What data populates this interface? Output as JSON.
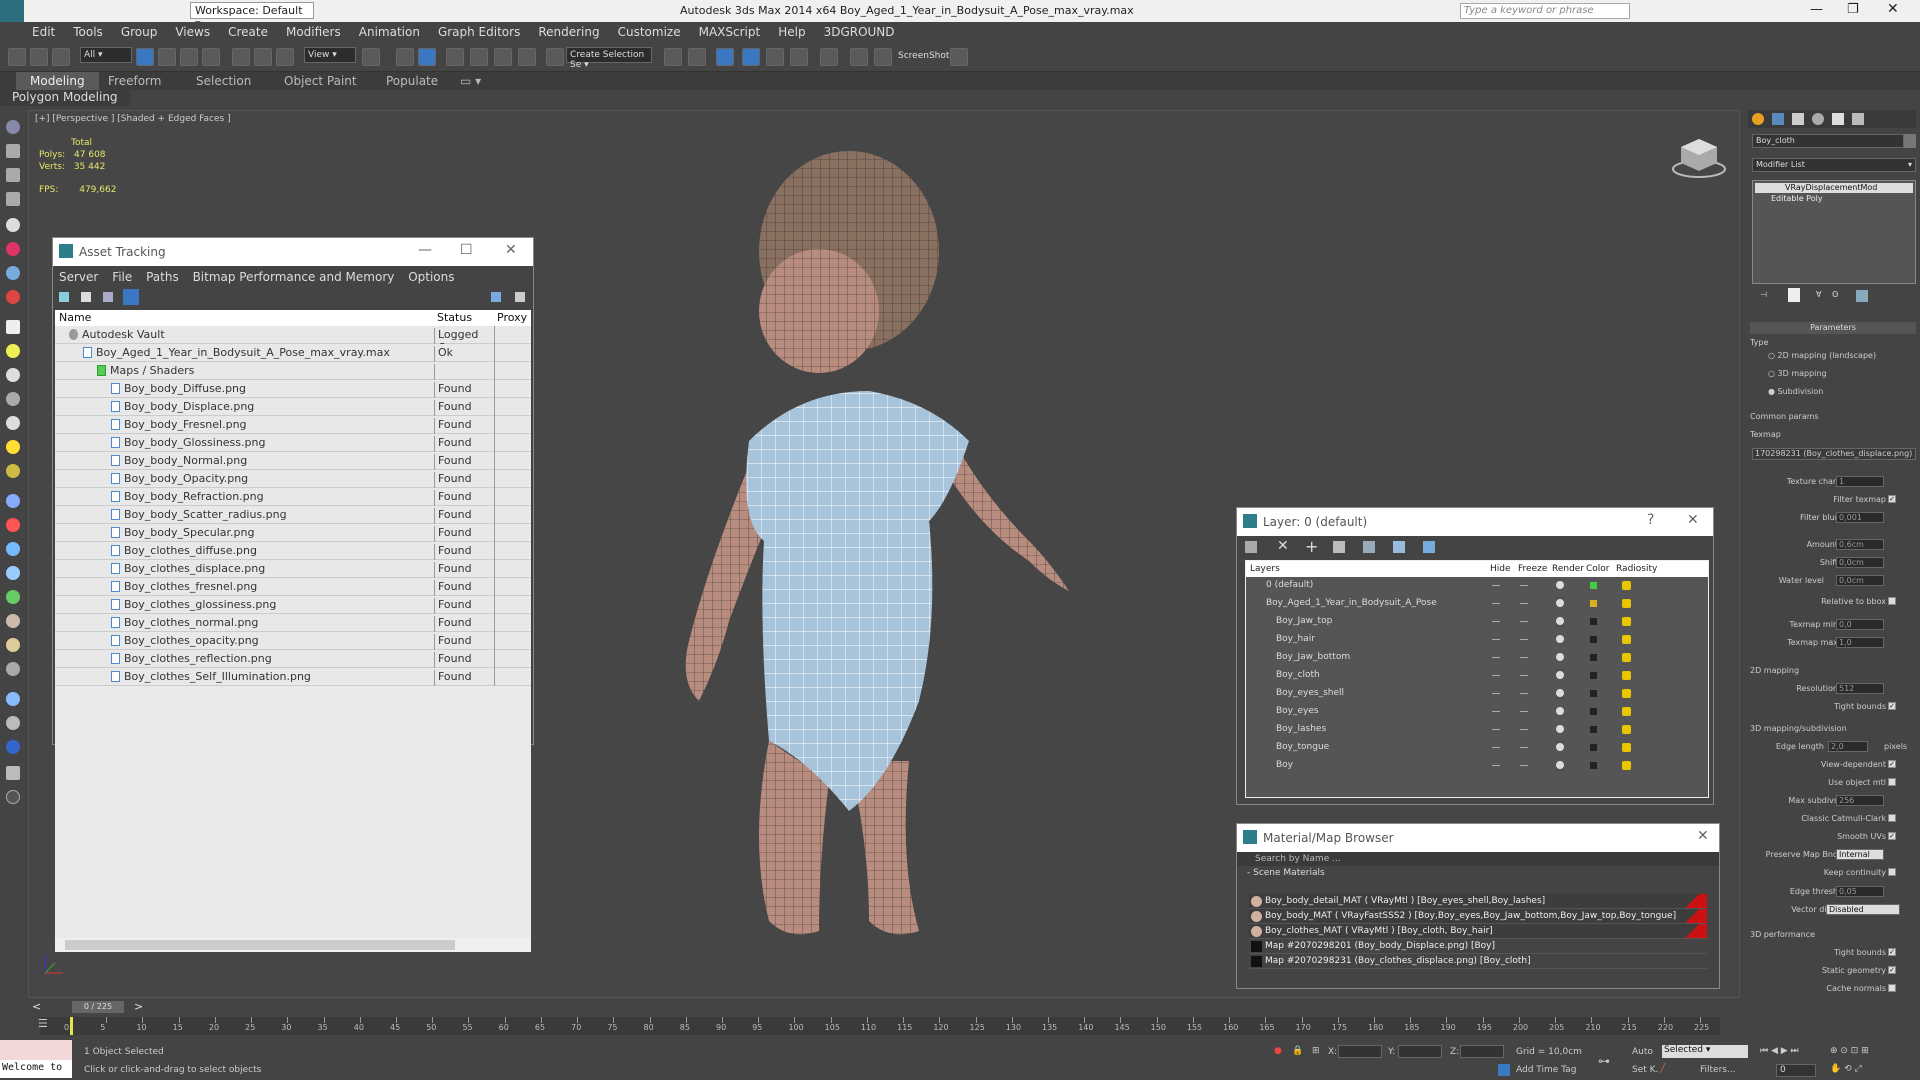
{
  "window": {
    "title": "Autodesk 3ds Max  2014 x64      Boy_Aged_1_Year_in_Bodysuit_A_Pose_max_vray.max",
    "workspace": "Workspace: Default",
    "search_placeholder": "Type a keyword or phrase"
  },
  "menu": [
    "Edit",
    "Tools",
    "Group",
    "Views",
    "Create",
    "Modifiers",
    "Animation",
    "Graph Editors",
    "Rendering",
    "Customize",
    "MAXScript",
    "Help",
    "3DGROUND"
  ],
  "toolbar": {
    "filter": "All",
    "view": "View",
    "selection_set": "Create Selection Se",
    "screenshot": "ScreenShot"
  },
  "ribbon": {
    "tabs": [
      "Modeling",
      "Freeform",
      "Selection",
      "Object Paint",
      "Populate"
    ],
    "subpanel": "Polygon Modeling"
  },
  "viewport": {
    "label": "[+] [Perspective ] [Shaded + Edged Faces ]",
    "stats_header": "Total",
    "polys_label": "Polys:",
    "polys": "47 608",
    "verts_label": "Verts:",
    "verts": "35 442",
    "fps_label": "FPS:",
    "fps": "479,662"
  },
  "asset_tracking": {
    "title": "Asset Tracking",
    "menu": [
      "Server",
      "File",
      "Paths",
      "Bitmap Performance and Memory",
      "Options"
    ],
    "columns": [
      "Name",
      "Status",
      "Proxy R"
    ],
    "rows": [
      {
        "name": "Autodesk Vault",
        "status": "Logged O...",
        "indent": 0
      },
      {
        "name": "Boy_Aged_1_Year_in_Bodysuit_A_Pose_max_vray.max",
        "status": "Ok",
        "indent": 1
      },
      {
        "name": "Maps / Shaders",
        "status": "",
        "indent": 2
      },
      {
        "name": "Boy_body_Diffuse.png",
        "status": "Found",
        "indent": 3
      },
      {
        "name": "Boy_body_Displace.png",
        "status": "Found",
        "indent": 3
      },
      {
        "name": "Boy_body_Fresnel.png",
        "status": "Found",
        "indent": 3
      },
      {
        "name": "Boy_body_Glossiness.png",
        "status": "Found",
        "indent": 3
      },
      {
        "name": "Boy_body_Normal.png",
        "status": "Found",
        "indent": 3
      },
      {
        "name": "Boy_body_Opacity.png",
        "status": "Found",
        "indent": 3
      },
      {
        "name": "Boy_body_Refraction.png",
        "status": "Found",
        "indent": 3
      },
      {
        "name": "Boy_body_Scatter_radius.png",
        "status": "Found",
        "indent": 3
      },
      {
        "name": "Boy_body_Specular.png",
        "status": "Found",
        "indent": 3
      },
      {
        "name": "Boy_clothes_diffuse.png",
        "status": "Found",
        "indent": 3
      },
      {
        "name": "Boy_clothes_displace.png",
        "status": "Found",
        "indent": 3
      },
      {
        "name": "Boy_clothes_fresnel.png",
        "status": "Found",
        "indent": 3
      },
      {
        "name": "Boy_clothes_glossiness.png",
        "status": "Found",
        "indent": 3
      },
      {
        "name": "Boy_clothes_normal.png",
        "status": "Found",
        "indent": 3
      },
      {
        "name": "Boy_clothes_opacity.png",
        "status": "Found",
        "indent": 3
      },
      {
        "name": "Boy_clothes_reflection.png",
        "status": "Found",
        "indent": 3
      },
      {
        "name": "Boy_clothes_Self_Illumination.png",
        "status": "Found",
        "indent": 3
      }
    ]
  },
  "layer": {
    "title": "Layer: 0 (default)",
    "help": "?",
    "columns": [
      "Layers",
      "Hide",
      "Freeze",
      "Render",
      "Color",
      "Radiosity"
    ],
    "rows": [
      {
        "name": "0 (default)",
        "indent": 1,
        "color": "#44cc44"
      },
      {
        "name": "Boy_Aged_1_Year_in_Bodysuit_A_Pose",
        "indent": 0,
        "color": "#d8b020"
      },
      {
        "name": "Boy_Jaw_top",
        "indent": 2,
        "color": "#222222"
      },
      {
        "name": "Boy_hair",
        "indent": 2,
        "color": "#222222"
      },
      {
        "name": "Boy_Jaw_bottom",
        "indent": 2,
        "color": "#222222"
      },
      {
        "name": "Boy_cloth",
        "indent": 2,
        "color": "#222222"
      },
      {
        "name": "Boy_eyes_shell",
        "indent": 2,
        "color": "#222222"
      },
      {
        "name": "Boy_eyes",
        "indent": 2,
        "color": "#222222"
      },
      {
        "name": "Boy_lashes",
        "indent": 2,
        "color": "#222222"
      },
      {
        "name": "Boy_tongue",
        "indent": 2,
        "color": "#222222"
      },
      {
        "name": "Boy",
        "indent": 2,
        "color": "#222222"
      }
    ]
  },
  "material_browser": {
    "title": "Material/Map Browser",
    "search": "Search by Name ...",
    "section": "- Scene Materials",
    "rows": [
      {
        "name": "Boy_body_detail_MAT ( VRayMtl ) [Boy_eyes_shell,Boy_lashes]",
        "type": "mat"
      },
      {
        "name": "Boy_body_MAT ( VRayFastSSS2 ) [Boy,Boy_eyes,Boy_Jaw_bottom,Boy_Jaw_top,Boy_tongue]",
        "type": "mat"
      },
      {
        "name": "Boy_clothes_MAT ( VRayMtl ) [Boy_cloth, Boy_hair]",
        "type": "mat"
      },
      {
        "name": "Map #2070298201 (Boy_body_Displace.png) [Boy]",
        "type": "map"
      },
      {
        "name": "Map #2070298231 (Boy_clothes_displace.png) [Boy_cloth]",
        "type": "map"
      }
    ]
  },
  "command_panel": {
    "object_name": "Boy_cloth",
    "modifier_list": "Modifier List",
    "stack": [
      "VRayDisplacementMod",
      "Editable Poly"
    ],
    "rollout": "Parameters",
    "type_label": "Type",
    "types": [
      "2D mapping (landscape)",
      "3D mapping",
      "Subdivision"
    ],
    "common_params": "Common params",
    "texmap_label": "Texmap",
    "texmap": "170298231 (Boy_clothes_displace.png)",
    "texture_chan_label": "Texture chan",
    "texture_chan": "1",
    "filter_texmap": "Filter texmap",
    "filter_blur_label": "Filter blur",
    "filter_blur": "0,001",
    "amount_label": "Amount",
    "amount": "0,6cm",
    "shift_label": "Shift",
    "shift": "0,0cm",
    "water_level_label": "Water level",
    "water_level": "0,0cm",
    "relative_bbox": "Relative to bbox",
    "texmap_min_label": "Texmap min",
    "texmap_min": "0,0",
    "texmap_max_label": "Texmap max",
    "texmap_max": "1,0",
    "mapping2d": "2D mapping",
    "resolution_label": "Resolution",
    "resolution": "512",
    "tight_bounds": "Tight bounds",
    "mapping3d": "3D mapping/subdivision",
    "edge_length_label": "Edge length",
    "edge_length": "2,0",
    "pixels": "pixels",
    "view_dependent": "View-dependent",
    "use_object_mtl": "Use object mtl",
    "max_subdivs_label": "Max subdivs",
    "max_subdivs": "256",
    "classic_catmull": "Classic Catmull-Clark",
    "smooth_uvs": "Smooth UVs",
    "preserve_map_label": "Preserve Map Bnd",
    "preserve_map": "Internal",
    "keep_continuity": "Keep continuity",
    "edge_thresh_label": "Edge thresh",
    "edge_thresh": "0,05",
    "vector_displ_label": "Vector displ",
    "vector_displ": "Disabled",
    "perf": "3D performance",
    "tight_bounds2": "Tight bounds",
    "static_geometry": "Static geometry",
    "cache_normals": "Cache normals"
  },
  "timeline": {
    "frame": "0 / 225",
    "ticks": [
      "0",
      "5",
      "10",
      "15",
      "20",
      "25",
      "30",
      "35",
      "40",
      "45",
      "50",
      "55",
      "60",
      "65",
      "70",
      "75",
      "80",
      "85",
      "90",
      "95",
      "100",
      "105",
      "110",
      "115",
      "120",
      "125",
      "130",
      "135",
      "140",
      "145",
      "150",
      "155",
      "160",
      "165",
      "170",
      "175",
      "180",
      "185",
      "190",
      "195",
      "200",
      "205",
      "210",
      "215",
      "220",
      "225"
    ]
  },
  "status": {
    "welcome": "Welcome to",
    "selected": "1 Object Selected",
    "hint": "Click or click-and-drag to select objects",
    "x_label": "X:",
    "y_label": "Y:",
    "z_label": "Z:",
    "grid": "Grid = 10,0cm",
    "add_time_tag": "Add Time Tag",
    "auto": "Auto",
    "set_k": "Set K.",
    "selected_dd": "Selected",
    "filters": "Filters...",
    "frame_field": "0"
  }
}
